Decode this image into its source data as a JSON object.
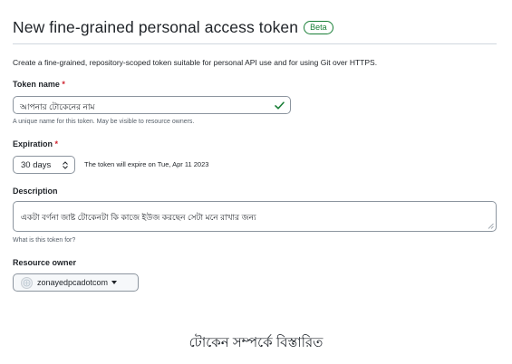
{
  "header": {
    "title": "New fine-grained personal access token",
    "badge": "Beta"
  },
  "intro": "Create a fine-grained, repository-scoped token suitable for personal API use and for using Git over HTTPS.",
  "token_name": {
    "label": "Token name",
    "required_mark": "*",
    "value": "আপনার টোকেনের নাম",
    "note": "A unique name for this token. May be visible to resource owners.",
    "valid_icon": "check-icon"
  },
  "expiration": {
    "label": "Expiration",
    "required_mark": "*",
    "selected": "30 days",
    "note": "The token will expire on Tue, Apr 11 2023"
  },
  "description": {
    "label": "Description",
    "value": "একটা বর্ণনা জাষ্ট টোকেনটা কি কাজে ইউজ করছেন সেটা মনে রাখার জন্য",
    "note": "What is this token for?"
  },
  "resource_owner": {
    "label": "Resource owner",
    "selected": "zonayedpcadotcom"
  },
  "caption": "টোকেন সম্পর্কে বিস্তারিত",
  "colors": {
    "accent_green": "#1a7f37",
    "required_red": "#cf222e",
    "border": "#8c959f"
  }
}
